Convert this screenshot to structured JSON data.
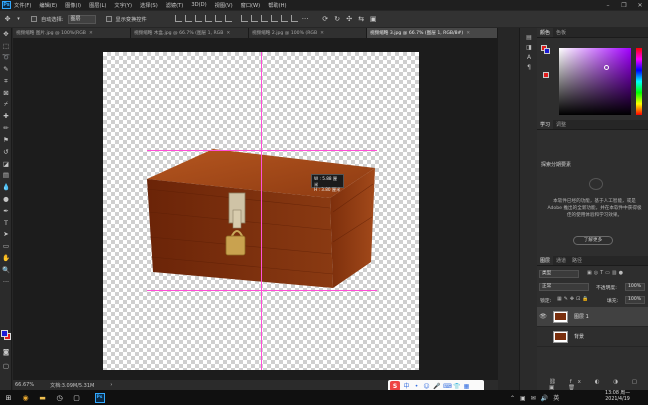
{
  "menubar": {
    "items": [
      "文件(F)",
      "编辑(E)",
      "图像(I)",
      "图层(L)",
      "文字(Y)",
      "选择(S)",
      "滤镜(T)",
      "3D(D)",
      "视图(V)",
      "窗口(W)",
      "帮助(H)"
    ]
  },
  "options": {
    "auto_select_label": "自动选择:",
    "auto_select_value": "图层",
    "show_transform_label": "显示变换控件"
  },
  "tabs": [
    {
      "label": "视频缩略 图片.jpg @ 100%(RGB",
      "active": false
    },
    {
      "label": "视频缩略 木盒.jpg @ 66.7% (图层 1, RGB",
      "active": false
    },
    {
      "label": "视频缩略 2.jpg @ 100% (RGB",
      "active": false
    },
    {
      "label": "视频缩略 3.jpg @ 66.7% (图层 1, RGB/8#)",
      "active": true
    }
  ],
  "canvas": {
    "tooltip_w": "W : 5.88 厘米",
    "tooltip_h": "H : 3.80 厘米"
  },
  "status": {
    "zoom": "66.67%",
    "doc": "文档:3.09M/5.31M"
  },
  "panels": {
    "color_tabs": [
      "颜色",
      "色板"
    ],
    "learn_tabs": [
      "学习",
      "调整"
    ],
    "learn_section": "探索分期要素",
    "learn_text": "本软件已经的功能，基于人工智能，或是 Adobe 推出的全新功能，并在本软件中获得极佳的使用体验和学习效果。",
    "learn_button": "了解更多",
    "layer_tabs": [
      "图层",
      "通道",
      "路径"
    ],
    "kind_label": "类型",
    "blend_mode": "正常",
    "opacity_label": "不透明度:",
    "opacity_value": "100%",
    "lock_label": "锁定:",
    "fill_label": "填充:",
    "fill_value": "100%",
    "layers": [
      {
        "name": "图层 1",
        "selected": true
      },
      {
        "name": "背景",
        "selected": false
      }
    ]
  },
  "taskbar": {
    "time": "13:08 周一",
    "date": "2021/4/19"
  },
  "colors": {
    "accent_guides": "#ff4fd8",
    "ps_blue": "#31a8ff",
    "foreground": "#1b1bd6",
    "background": "#e01c1c"
  }
}
